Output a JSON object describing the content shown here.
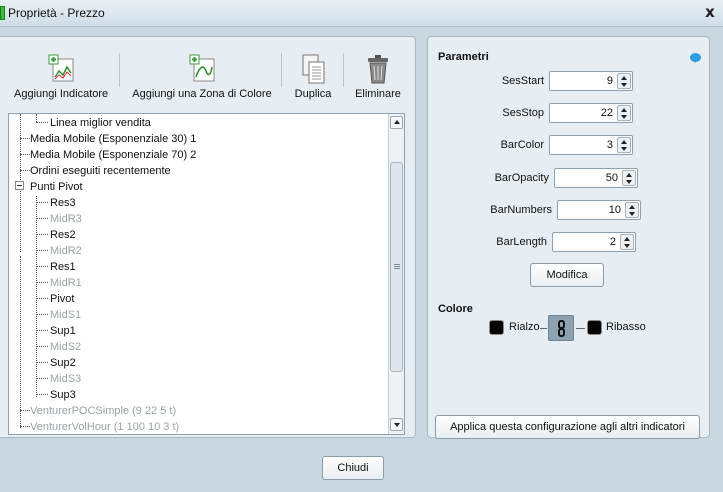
{
  "window": {
    "title": "Proprietà - Prezzo",
    "close_glyph": "x"
  },
  "toolbar": {
    "add_indicator": "Aggiungi Indicatore",
    "add_color_zone": "Aggiungi una Zona di Colore",
    "duplicate": "Duplica",
    "delete": "Eliminare"
  },
  "tree": {
    "items": [
      {
        "label": "Linea miglior vendita",
        "dim": false
      },
      {
        "label": "Media Mobile (Esponenziale 30) 1",
        "dim": false
      },
      {
        "label": "Media Mobile (Esponenziale 70) 2",
        "dim": false
      },
      {
        "label": "Ordini eseguiti recentemente",
        "dim": false
      },
      {
        "label": "Punti Pivot",
        "dim": false
      },
      {
        "label": "Res3",
        "dim": false
      },
      {
        "label": "MidR3",
        "dim": true
      },
      {
        "label": "Res2",
        "dim": false
      },
      {
        "label": "MidR2",
        "dim": true
      },
      {
        "label": "Res1",
        "dim": false
      },
      {
        "label": "MidR1",
        "dim": true
      },
      {
        "label": "Pivot",
        "dim": false
      },
      {
        "label": "MidS1",
        "dim": true
      },
      {
        "label": "Sup1",
        "dim": false
      },
      {
        "label": "MidS2",
        "dim": true
      },
      {
        "label": "Sup2",
        "dim": false
      },
      {
        "label": "MidS3",
        "dim": true
      },
      {
        "label": "Sup3",
        "dim": false
      },
      {
        "label": "VenturerPOCSimple (9 22 5 t)",
        "dim": true
      },
      {
        "label": "VenturerVolHour (1 100 10 3 t)",
        "dim": true
      }
    ]
  },
  "params": {
    "heading": "Parametri",
    "fields": [
      {
        "label": "SesStart",
        "value": "9"
      },
      {
        "label": "SesStop",
        "value": "22"
      },
      {
        "label": "BarColor",
        "value": "3"
      },
      {
        "label": "BarOpacity",
        "value": "50"
      },
      {
        "label": "BarNumbers",
        "value": "10"
      },
      {
        "label": "BarLength",
        "value": "2"
      }
    ],
    "modify_button": "Modifica"
  },
  "colors": {
    "heading": "Colore",
    "up_label": "Rialzo",
    "down_label": "Ribasso",
    "up_color": "#050505",
    "down_color": "#050505"
  },
  "apply_button": "Applica questa configurazione agli altri indicatori",
  "close_button": "Chiudi"
}
